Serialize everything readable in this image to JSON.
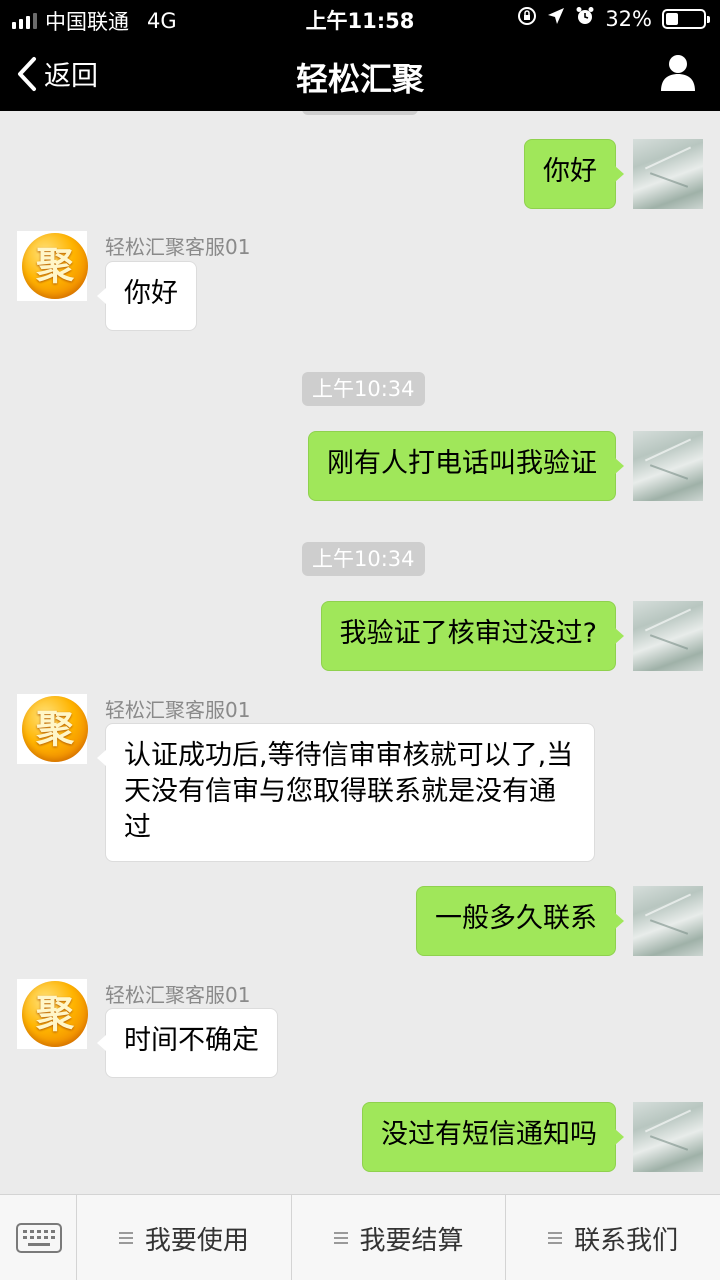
{
  "status_bar": {
    "carrier": "中国联通",
    "network": "4G",
    "time": "上午11:58",
    "battery": "32%",
    "battery_level": 0.32
  },
  "nav": {
    "back_label": "返回",
    "title": "轻松汇聚"
  },
  "messages": {
    "m1": "你好",
    "agent1_name": "轻松汇聚客服01",
    "a1": "你好",
    "ts1": "上午10:34",
    "m2": "刚有人打电话叫我验证",
    "ts2": "上午10:34",
    "m3": "我验证了核审过没过?",
    "agent2_name": "轻松汇聚客服01",
    "a2": "认证成功后,等待信审审核就可以了,当天没有信审与您取得联系就是没有通过",
    "m4": "一般多久联系",
    "agent3_name": "轻松汇聚客服01",
    "a3": "时间不确定",
    "m5": "没过有短信通知吗"
  },
  "agent_avatar_glyph": "聚",
  "bottom_menu": {
    "btn1": "我要使用",
    "btn2": "我要结算",
    "btn3": "联系我们"
  },
  "colors": {
    "my_bubble": "#a0e75a",
    "agent_bubble": "#ffffff",
    "chat_bg": "#ebebeb",
    "header": "#000000"
  }
}
